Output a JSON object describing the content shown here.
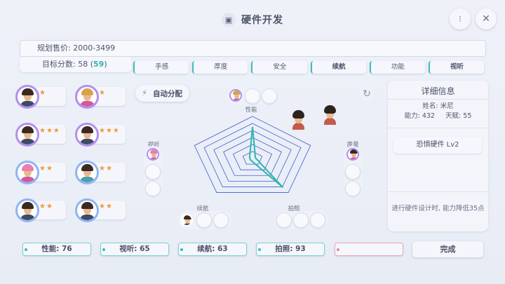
{
  "header": {
    "title": "硬件开发",
    "title_icon": "box-icon",
    "info_button_icon": "info-icon",
    "close_button_icon": "close-icon"
  },
  "plan": {
    "price_label": "规划售价: 2000-3499",
    "score_prefix": "目标分数: 58 (",
    "score_highlight": "59",
    "score_suffix": ")"
  },
  "tabs": [
    {
      "label": "手感",
      "bold": false
    },
    {
      "label": "厚度",
      "bold": false
    },
    {
      "label": "安全",
      "bold": false
    },
    {
      "label": "续航",
      "bold": true
    },
    {
      "label": "功能",
      "bold": false
    },
    {
      "label": "视听",
      "bold": true
    }
  ],
  "staff": [
    {
      "stars": "★",
      "hair": "dark",
      "ring": "purple"
    },
    {
      "stars": "★",
      "hair": "blond",
      "ring": "purple"
    },
    {
      "stars": "★★★",
      "hair": "dark",
      "ring": "purple"
    },
    {
      "stars": "★★★",
      "hair": "dark",
      "ring": "purple"
    },
    {
      "stars": "★★",
      "hair": "pink",
      "ring": "blue"
    },
    {
      "stars": "★★",
      "hair": "dark",
      "ring": "blue"
    },
    {
      "stars": "★★",
      "hair": "dark",
      "ring": "blue"
    },
    {
      "stars": "★★",
      "hair": "dark",
      "ring": "blue"
    }
  ],
  "auto_assign_label": "自动分配",
  "slots": {
    "performance": "性能",
    "audiovisual": "视听",
    "quality": "质量",
    "battery": "续航",
    "camera": "拍照"
  },
  "detail": {
    "title": "详细信息",
    "name": "姓名: 米尼",
    "stats": "能力: 432     天赋: 55",
    "trait": "恐惧硬件 Lv2",
    "description": "进行硬件设计时, 能力降低35点"
  },
  "bottom": {
    "performance": "性能: 76",
    "audiovisual": "视听: 65",
    "battery": "续航: 63",
    "camera": "拍照: 93",
    "empty": "",
    "finish": "完成"
  },
  "colors": {
    "accent": "#3bbfb8",
    "star": "#ef9a3c",
    "radar_grid": "#3f5fd6",
    "radar_fill": "#2fb5b0"
  },
  "chart_data": {
    "type": "radar",
    "axes": [
      "性能",
      "质量",
      "拍照",
      "续航",
      "视听"
    ],
    "values": [
      0.75,
      0.05,
      0.85,
      0.05,
      0.05
    ],
    "rings": 6
  }
}
